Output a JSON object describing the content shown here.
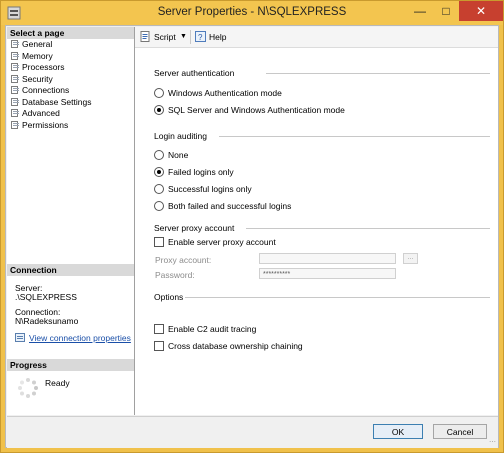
{
  "window": {
    "title": "Server Properties - N\\SQLEXPRESS"
  },
  "select_page": {
    "header": "Select a page",
    "items": [
      "General",
      "Memory",
      "Processors",
      "Security",
      "Connections",
      "Database Settings",
      "Advanced",
      "Permissions"
    ]
  },
  "connection": {
    "header": "Connection",
    "server_label": "Server:",
    "server_value": ".\\SQLEXPRESS",
    "connection_label": "Connection:",
    "connection_value": "N\\Radeksunamo",
    "view_link": "View connection properties"
  },
  "progress": {
    "header": "Progress",
    "status": "Ready"
  },
  "toolbar": {
    "script_label": "Script",
    "help_label": "Help"
  },
  "server_auth": {
    "title": "Server authentication",
    "options": [
      "Windows Authentication mode",
      "SQL Server and Windows Authentication mode"
    ],
    "selected": 1
  },
  "login_auditing": {
    "title": "Login auditing",
    "options": [
      "None",
      "Failed logins only",
      "Successful logins only",
      "Both failed and successful logins"
    ],
    "selected": 1
  },
  "proxy": {
    "title": "Server proxy account",
    "enable_label": "Enable server proxy account",
    "proxy_account_label": "Proxy account:",
    "proxy_account_value": "",
    "password_label": "Password:",
    "password_value": "**********",
    "browse_label": "..."
  },
  "options": {
    "title": "Options",
    "c2_label": "Enable C2 audit tracing",
    "cross_db_label": "Cross database ownership chaining"
  },
  "buttons": {
    "ok": "OK",
    "cancel": "Cancel"
  },
  "icons": [
    "app-icon",
    "minimize-icon",
    "maximize-icon",
    "close-icon",
    "page-icon",
    "script-icon",
    "dropdown-arrow-icon",
    "help-icon",
    "connection-properties-icon",
    "progress-spinner-icon",
    "resize-grip-icon"
  ],
  "colors": {
    "title_bar": "#f3c54f",
    "close_button": "#c7402f",
    "link": "#1a4fa8"
  }
}
